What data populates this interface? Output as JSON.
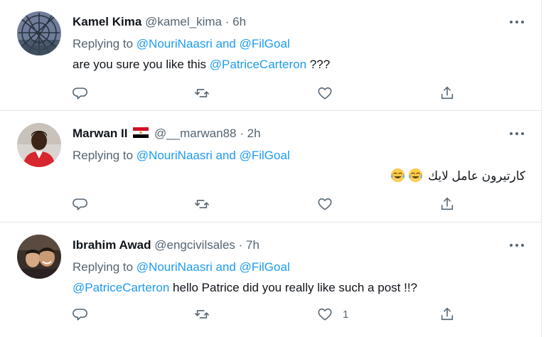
{
  "tweets": [
    {
      "name": "Kamel Kima",
      "handle": "@kamel_kima",
      "dot": "·",
      "time": "6h",
      "replying_prefix": "Replying to",
      "replying_to": "@NouriNaasri and @FilGoal",
      "mention": "@PatriceCarteron",
      "text_before": "are you sure you like this ",
      "text_after": " ???",
      "likes": ""
    },
    {
      "name": "Marwan II",
      "flag": "egypt-flag-icon",
      "handle": "@__marwan88",
      "dot": "·",
      "time": "2h",
      "replying_prefix": "Replying to",
      "replying_to": "@NouriNaasri and @FilGoal",
      "text": "كارتيرون عامل لايك",
      "emoji": "tears-of-joy-emoji",
      "likes": ""
    },
    {
      "name": "Ibrahim Awad",
      "handle": "@engcivilsales",
      "dot": "·",
      "time": "7h",
      "replying_prefix": "Replying to",
      "replying_to": "@NouriNaasri and @FilGoal",
      "mention": "@PatriceCarteron",
      "text_after": " hello Patrice did you really like such a post !!?",
      "likes": "1"
    }
  ],
  "icons": {
    "reply": "reply-icon",
    "retweet": "retweet-icon",
    "like": "heart-icon",
    "share": "share-icon",
    "more": "more-options-icon"
  },
  "colors": {
    "link": "#1d9bf0",
    "secondary": "#536471",
    "text": "#0f1419",
    "divider": "#e1e8ed"
  }
}
